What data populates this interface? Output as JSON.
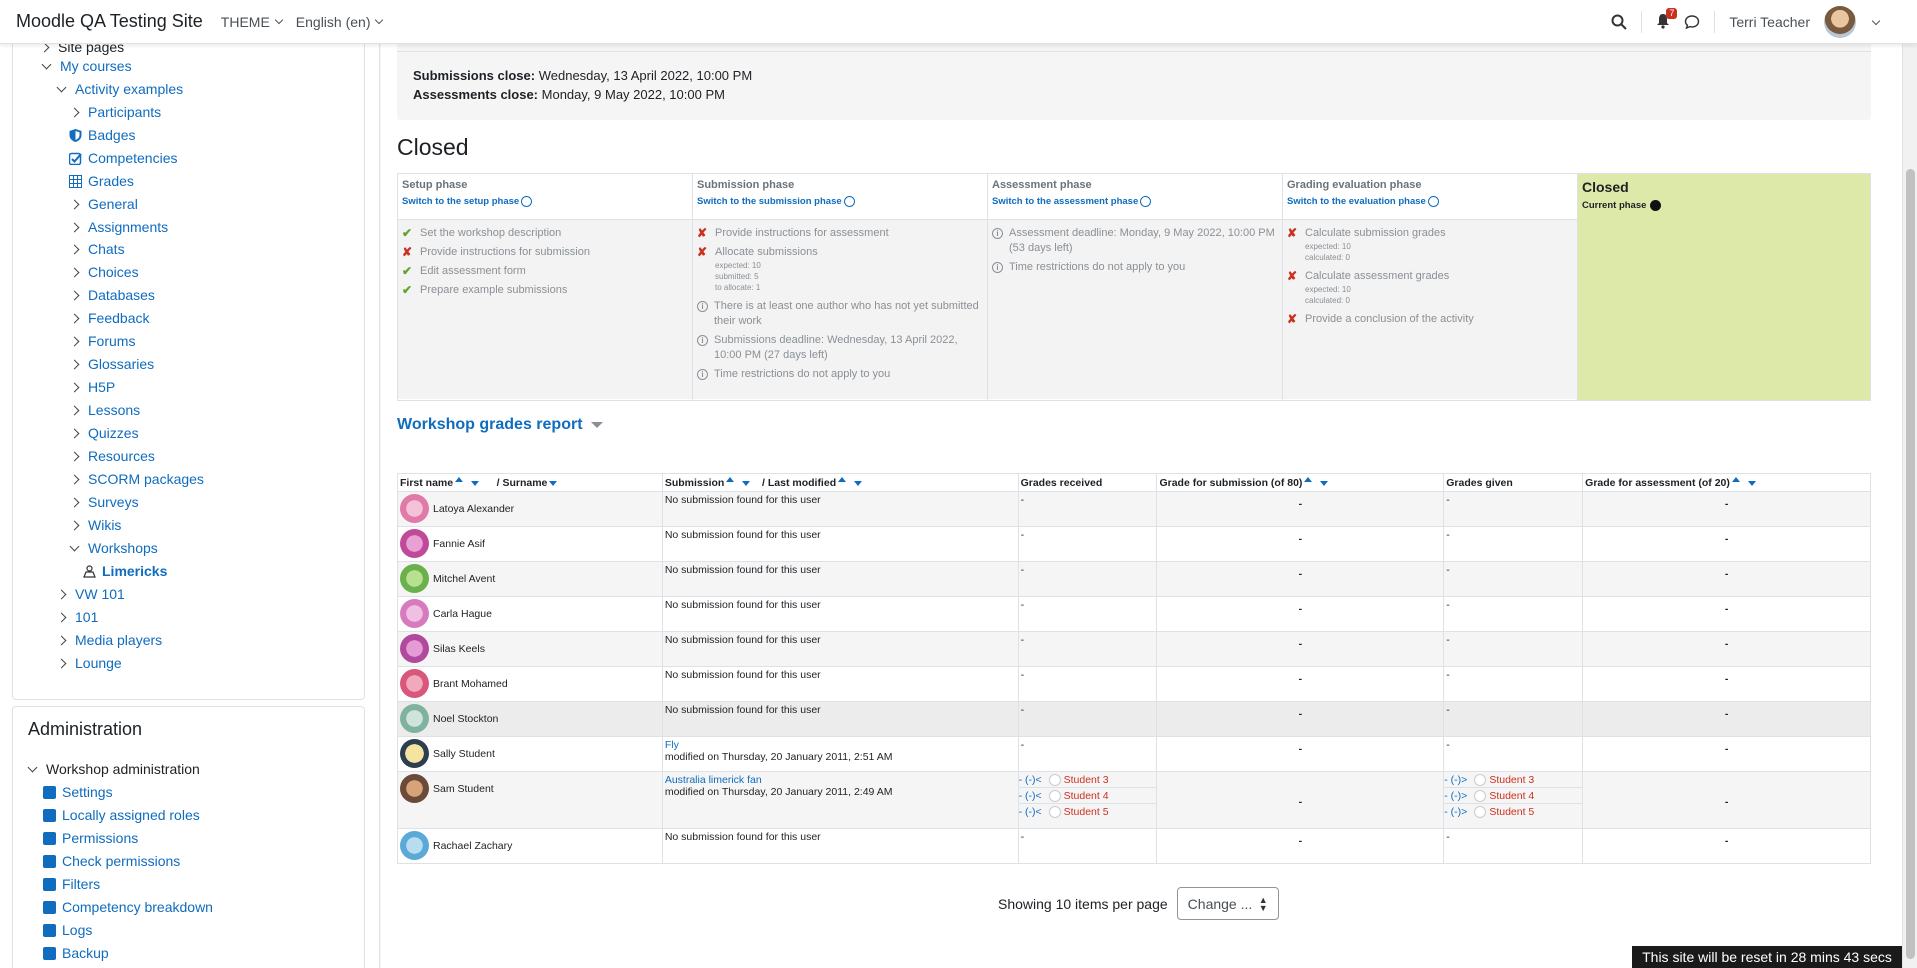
{
  "navbar": {
    "brand": "Moodle QA Testing Site",
    "theme_menu": "THEME",
    "language_menu": "English (en)",
    "notification_count": "7",
    "user_name": "Terri Teacher"
  },
  "nav_tree": {
    "site_pages": "Site pages",
    "my_courses": "My courses",
    "course": "Activity examples",
    "items": [
      "Participants",
      "Badges",
      "Competencies",
      "Grades",
      "General",
      "Assignments",
      "Chats",
      "Choices",
      "Databases",
      "Feedback",
      "Forums",
      "Glossaries",
      "H5P",
      "Lessons",
      "Quizzes",
      "Resources",
      "SCORM packages",
      "Surveys",
      "Wikis",
      "Workshops"
    ],
    "current_activity": "Limericks",
    "other_courses": [
      "VW 101",
      "101",
      "Media players",
      "Lounge"
    ]
  },
  "admin": {
    "title": "Administration",
    "section": "Workshop administration",
    "items": [
      "Settings",
      "Locally assigned roles",
      "Permissions",
      "Check permissions",
      "Filters",
      "Competency breakdown",
      "Logs",
      "Backup"
    ]
  },
  "deadlines": {
    "submissions_label": "Submissions close:",
    "submissions_value": "Wednesday, 13 April 2022, 10:00 PM",
    "assessments_label": "Assessments close:",
    "assessments_value": "Monday, 9 May 2022, 10:00 PM"
  },
  "current_phase_title": "Closed",
  "phases": {
    "setup": {
      "name": "Setup phase",
      "switch": "Switch to the setup phase",
      "tasks": [
        "Set the workshop description",
        "Provide instructions for submission",
        "Edit assessment form",
        "Prepare example submissions"
      ]
    },
    "submission": {
      "name": "Submission phase",
      "switch": "Switch to the submission phase",
      "t1": "Provide instructions for assessment",
      "t2": "Allocate submissions",
      "t2_expected": "expected: 10",
      "t2_submitted": "submitted: 5",
      "t2_allocate": "to allocate: 1",
      "t3": "There is at least one author who has not yet submitted their work",
      "t4": "Submissions deadline: Wednesday, 13 April 2022, 10:00 PM (27 days left)",
      "t5": "Time restrictions do not apply to you"
    },
    "assessment": {
      "name": "Assessment phase",
      "switch": "Switch to the assessment phase",
      "t1": "Assessment deadline: Monday, 9 May 2022, 10:00 PM (53 days left)",
      "t2": "Time restrictions do not apply to you"
    },
    "evaluation": {
      "name": "Grading evaluation phase",
      "switch": "Switch to the evaluation phase",
      "t1": "Calculate submission grades",
      "t1_expected": "expected: 10",
      "t1_calculated": "calculated: 0",
      "t2": "Calculate assessment grades",
      "t2_expected": "expected: 10",
      "t2_calculated": "calculated: 0",
      "t3": "Provide a conclusion of the activity"
    },
    "closed": {
      "name": "Closed",
      "current": "Current phase"
    }
  },
  "report": {
    "title": "Workshop grades report",
    "headers": {
      "first_name": "First name",
      "surname": "/ Surname",
      "submission": "Submission",
      "last_modified": "/ Last modified",
      "grades_received": "Grades received",
      "grade_submission": "Grade for submission (of 80)",
      "grades_given": "Grades given",
      "grade_assessment": "Grade for assessment (of 20)"
    },
    "no_submission": "No submission found for this user",
    "dash": "-",
    "rows": [
      {
        "name": "Latoya Alexander",
        "color": "#e07aa8"
      },
      {
        "name": "Fannie Asif",
        "color": "#c04a9a"
      },
      {
        "name": "Mitchel Avent",
        "color": "#6ab04c"
      },
      {
        "name": "Carla Hague",
        "color": "#d77bbf"
      },
      {
        "name": "Silas Keels",
        "color": "#b04a9c"
      },
      {
        "name": "Brant Mohamed",
        "color": "#d9577a"
      },
      {
        "name": "Noel Stockton",
        "color": "#7fb3a0"
      },
      {
        "name": "Sally Student",
        "color": "#2c3e50"
      },
      {
        "name": "Sam Student",
        "color": "#6b4a3a"
      },
      {
        "name": "Rachael Zachary",
        "color": "#5aa9d6"
      }
    ],
    "sally": {
      "submission": "Fly",
      "modified": "modified on Thursday, 20 January 2011, 2:51 AM"
    },
    "sam": {
      "submission": "Australia limerick fan",
      "modified": "modified on Thursday, 20 January 2011, 2:49 AM",
      "received_prefix": "- (-)<",
      "given_prefix": "- (-)>",
      "students": [
        "Student 3",
        "Student 4",
        "Student 5"
      ]
    }
  },
  "pager": {
    "text": "Showing 10 items per page",
    "select": "Change ..."
  },
  "reset_notice": "This site will be reset in 28 mins 43 secs"
}
